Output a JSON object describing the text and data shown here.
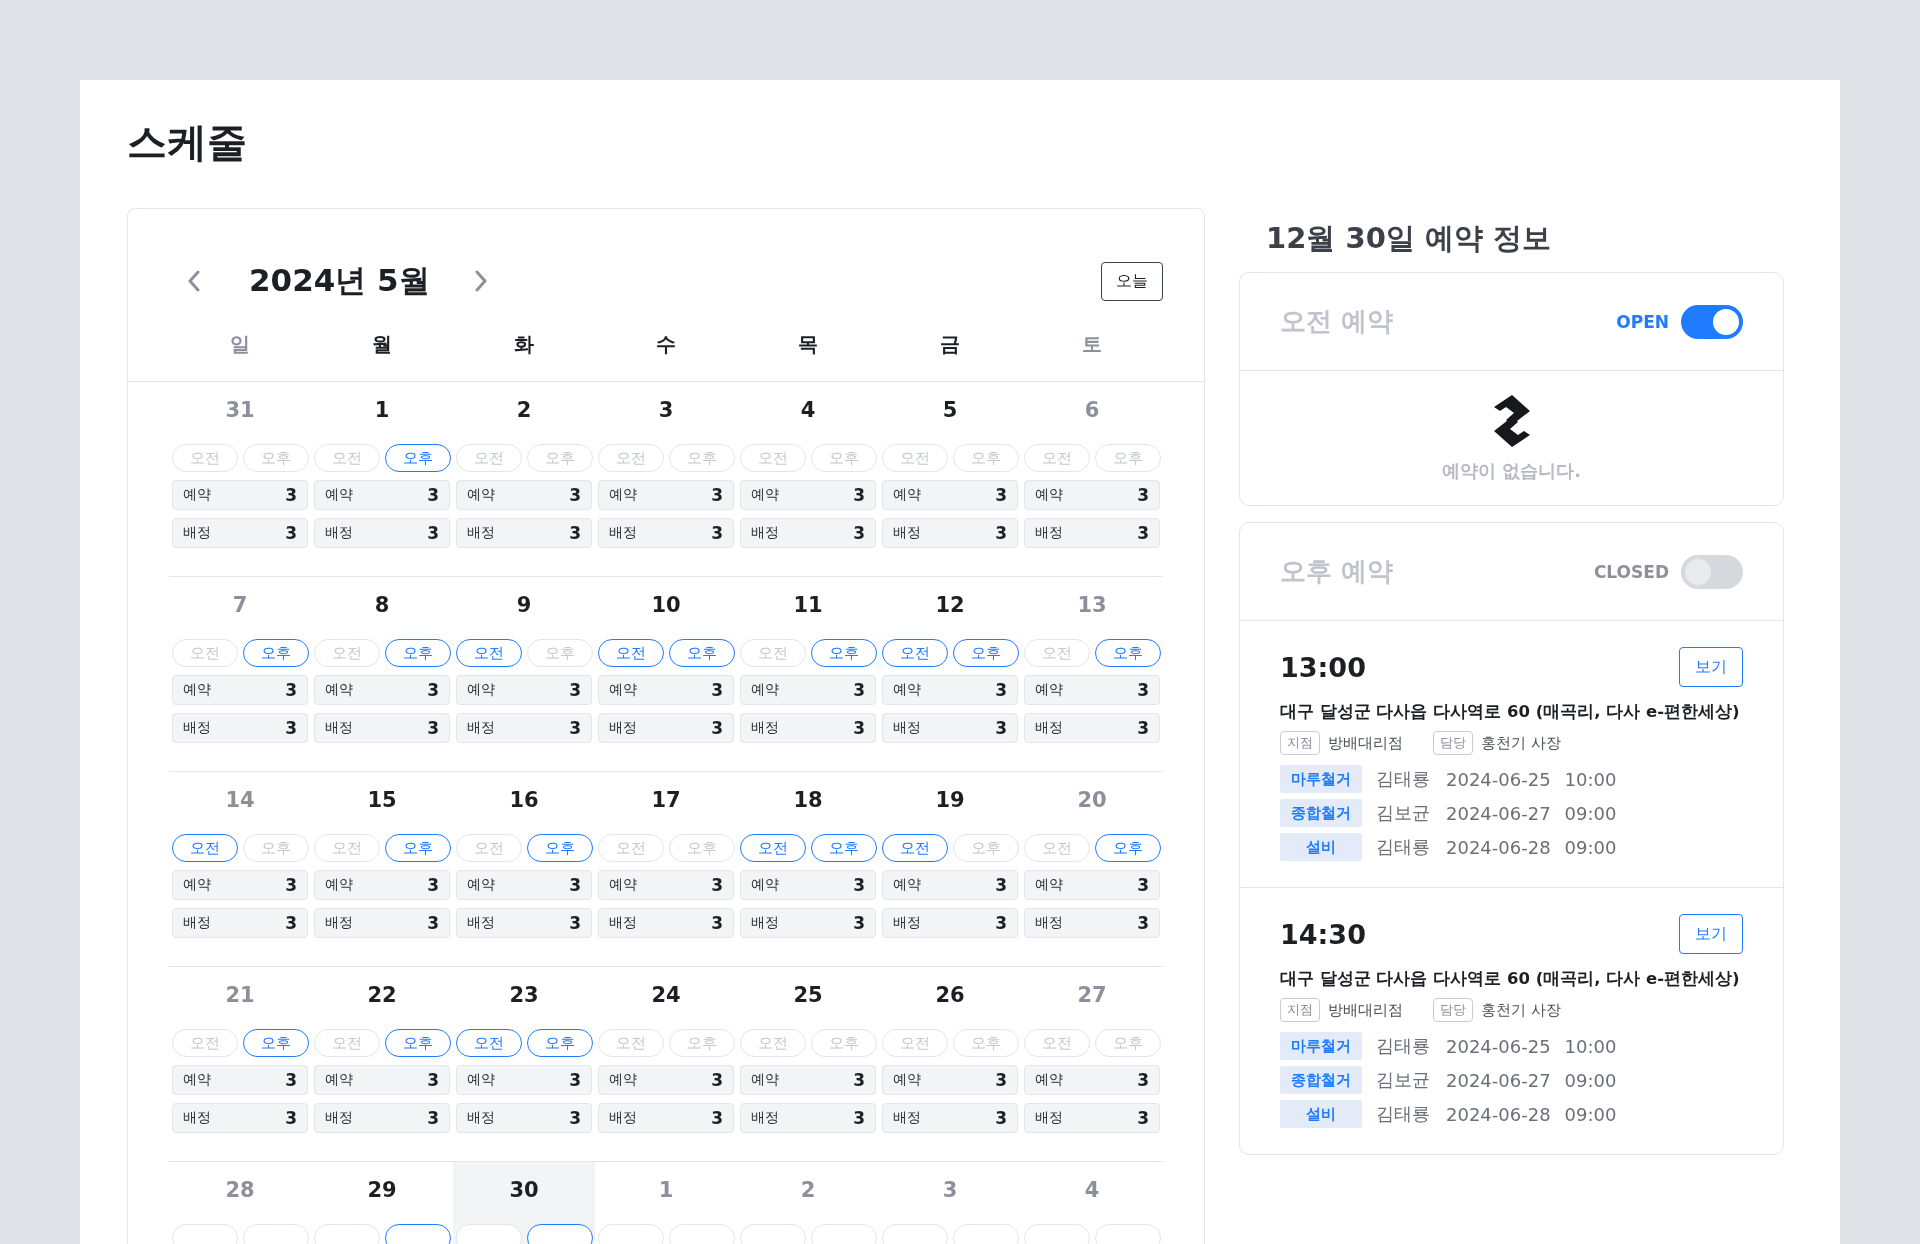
{
  "page": {
    "title": "스케줄"
  },
  "calendar": {
    "month_title": "2024년 5월",
    "today_button": "오늘",
    "weekdays": [
      {
        "label": "일",
        "muted": true
      },
      {
        "label": "월",
        "muted": false
      },
      {
        "label": "화",
        "muted": false
      },
      {
        "label": "수",
        "muted": false
      },
      {
        "label": "목",
        "muted": false
      },
      {
        "label": "금",
        "muted": false
      },
      {
        "label": "토",
        "muted": true
      }
    ],
    "weeks": [
      {
        "days": [
          {
            "date": "31",
            "muted": true,
            "selected": false,
            "slots": [
              {
                "label": "오전",
                "selected": false
              },
              {
                "label": "오후",
                "selected": false
              }
            ],
            "counts": [
              {
                "label": "예약",
                "value": "3"
              },
              {
                "label": "배정",
                "value": "3"
              }
            ]
          },
          {
            "date": "1",
            "muted": false,
            "selected": false,
            "slots": [
              {
                "label": "오전",
                "selected": false
              },
              {
                "label": "오후",
                "selected": true
              }
            ],
            "counts": [
              {
                "label": "예약",
                "value": "3"
              },
              {
                "label": "배정",
                "value": "3"
              }
            ]
          },
          {
            "date": "2",
            "muted": false,
            "selected": false,
            "slots": [
              {
                "label": "오전",
                "selected": false
              },
              {
                "label": "오후",
                "selected": false
              }
            ],
            "counts": [
              {
                "label": "예약",
                "value": "3"
              },
              {
                "label": "배정",
                "value": "3"
              }
            ]
          },
          {
            "date": "3",
            "muted": false,
            "selected": false,
            "slots": [
              {
                "label": "오전",
                "selected": false
              },
              {
                "label": "오후",
                "selected": false
              }
            ],
            "counts": [
              {
                "label": "예약",
                "value": "3"
              },
              {
                "label": "배정",
                "value": "3"
              }
            ]
          },
          {
            "date": "4",
            "muted": false,
            "selected": false,
            "slots": [
              {
                "label": "오전",
                "selected": false
              },
              {
                "label": "오후",
                "selected": false
              }
            ],
            "counts": [
              {
                "label": "예약",
                "value": "3"
              },
              {
                "label": "배정",
                "value": "3"
              }
            ]
          },
          {
            "date": "5",
            "muted": false,
            "selected": false,
            "slots": [
              {
                "label": "오전",
                "selected": false
              },
              {
                "label": "오후",
                "selected": false
              }
            ],
            "counts": [
              {
                "label": "예약",
                "value": "3"
              },
              {
                "label": "배정",
                "value": "3"
              }
            ]
          },
          {
            "date": "6",
            "muted": true,
            "selected": false,
            "slots": [
              {
                "label": "오전",
                "selected": false
              },
              {
                "label": "오후",
                "selected": false
              }
            ],
            "counts": [
              {
                "label": "예약",
                "value": "3"
              },
              {
                "label": "배정",
                "value": "3"
              }
            ]
          }
        ]
      },
      {
        "days": [
          {
            "date": "7",
            "muted": true,
            "selected": false,
            "slots": [
              {
                "label": "오전",
                "selected": false
              },
              {
                "label": "오후",
                "selected": true
              }
            ],
            "counts": [
              {
                "label": "예약",
                "value": "3"
              },
              {
                "label": "배정",
                "value": "3"
              }
            ]
          },
          {
            "date": "8",
            "muted": false,
            "selected": false,
            "slots": [
              {
                "label": "오전",
                "selected": false
              },
              {
                "label": "오후",
                "selected": true
              }
            ],
            "counts": [
              {
                "label": "예약",
                "value": "3"
              },
              {
                "label": "배정",
                "value": "3"
              }
            ]
          },
          {
            "date": "9",
            "muted": false,
            "selected": false,
            "slots": [
              {
                "label": "오전",
                "selected": true
              },
              {
                "label": "오후",
                "selected": false
              }
            ],
            "counts": [
              {
                "label": "예약",
                "value": "3"
              },
              {
                "label": "배정",
                "value": "3"
              }
            ]
          },
          {
            "date": "10",
            "muted": false,
            "selected": false,
            "slots": [
              {
                "label": "오전",
                "selected": true
              },
              {
                "label": "오후",
                "selected": true
              }
            ],
            "counts": [
              {
                "label": "예약",
                "value": "3"
              },
              {
                "label": "배정",
                "value": "3"
              }
            ]
          },
          {
            "date": "11",
            "muted": false,
            "selected": false,
            "slots": [
              {
                "label": "오전",
                "selected": false
              },
              {
                "label": "오후",
                "selected": true
              }
            ],
            "counts": [
              {
                "label": "예약",
                "value": "3"
              },
              {
                "label": "배정",
                "value": "3"
              }
            ]
          },
          {
            "date": "12",
            "muted": false,
            "selected": false,
            "slots": [
              {
                "label": "오전",
                "selected": true
              },
              {
                "label": "오후",
                "selected": true
              }
            ],
            "counts": [
              {
                "label": "예약",
                "value": "3"
              },
              {
                "label": "배정",
                "value": "3"
              }
            ]
          },
          {
            "date": "13",
            "muted": true,
            "selected": false,
            "slots": [
              {
                "label": "오전",
                "selected": false
              },
              {
                "label": "오후",
                "selected": true
              }
            ],
            "counts": [
              {
                "label": "예약",
                "value": "3"
              },
              {
                "label": "배정",
                "value": "3"
              }
            ]
          }
        ]
      },
      {
        "days": [
          {
            "date": "14",
            "muted": true,
            "selected": false,
            "slots": [
              {
                "label": "오전",
                "selected": true
              },
              {
                "label": "오후",
                "selected": false
              }
            ],
            "counts": [
              {
                "label": "예약",
                "value": "3"
              },
              {
                "label": "배정",
                "value": "3"
              }
            ]
          },
          {
            "date": "15",
            "muted": false,
            "selected": false,
            "slots": [
              {
                "label": "오전",
                "selected": false
              },
              {
                "label": "오후",
                "selected": true
              }
            ],
            "counts": [
              {
                "label": "예약",
                "value": "3"
              },
              {
                "label": "배정",
                "value": "3"
              }
            ]
          },
          {
            "date": "16",
            "muted": false,
            "selected": false,
            "slots": [
              {
                "label": "오전",
                "selected": false
              },
              {
                "label": "오후",
                "selected": true
              }
            ],
            "counts": [
              {
                "label": "예약",
                "value": "3"
              },
              {
                "label": "배정",
                "value": "3"
              }
            ]
          },
          {
            "date": "17",
            "muted": false,
            "selected": false,
            "slots": [
              {
                "label": "오전",
                "selected": false
              },
              {
                "label": "오후",
                "selected": false
              }
            ],
            "counts": [
              {
                "label": "예약",
                "value": "3"
              },
              {
                "label": "배정",
                "value": "3"
              }
            ]
          },
          {
            "date": "18",
            "muted": false,
            "selected": false,
            "slots": [
              {
                "label": "오전",
                "selected": true
              },
              {
                "label": "오후",
                "selected": true
              }
            ],
            "counts": [
              {
                "label": "예약",
                "value": "3"
              },
              {
                "label": "배정",
                "value": "3"
              }
            ]
          },
          {
            "date": "19",
            "muted": false,
            "selected": false,
            "slots": [
              {
                "label": "오전",
                "selected": true
              },
              {
                "label": "오후",
                "selected": false
              }
            ],
            "counts": [
              {
                "label": "예약",
                "value": "3"
              },
              {
                "label": "배정",
                "value": "3"
              }
            ]
          },
          {
            "date": "20",
            "muted": true,
            "selected": false,
            "slots": [
              {
                "label": "오전",
                "selected": false
              },
              {
                "label": "오후",
                "selected": true
              }
            ],
            "counts": [
              {
                "label": "예약",
                "value": "3"
              },
              {
                "label": "배정",
                "value": "3"
              }
            ]
          }
        ]
      },
      {
        "days": [
          {
            "date": "21",
            "muted": true,
            "selected": false,
            "slots": [
              {
                "label": "오전",
                "selected": false
              },
              {
                "label": "오후",
                "selected": true
              }
            ],
            "counts": [
              {
                "label": "예약",
                "value": "3"
              },
              {
                "label": "배정",
                "value": "3"
              }
            ]
          },
          {
            "date": "22",
            "muted": false,
            "selected": false,
            "slots": [
              {
                "label": "오전",
                "selected": false
              },
              {
                "label": "오후",
                "selected": true
              }
            ],
            "counts": [
              {
                "label": "예약",
                "value": "3"
              },
              {
                "label": "배정",
                "value": "3"
              }
            ]
          },
          {
            "date": "23",
            "muted": false,
            "selected": false,
            "slots": [
              {
                "label": "오전",
                "selected": true
              },
              {
                "label": "오후",
                "selected": true
              }
            ],
            "counts": [
              {
                "label": "예약",
                "value": "3"
              },
              {
                "label": "배정",
                "value": "3"
              }
            ]
          },
          {
            "date": "24",
            "muted": false,
            "selected": false,
            "slots": [
              {
                "label": "오전",
                "selected": false
              },
              {
                "label": "오후",
                "selected": false
              }
            ],
            "counts": [
              {
                "label": "예약",
                "value": "3"
              },
              {
                "label": "배정",
                "value": "3"
              }
            ]
          },
          {
            "date": "25",
            "muted": false,
            "selected": false,
            "slots": [
              {
                "label": "오전",
                "selected": false
              },
              {
                "label": "오후",
                "selected": false
              }
            ],
            "counts": [
              {
                "label": "예약",
                "value": "3"
              },
              {
                "label": "배정",
                "value": "3"
              }
            ]
          },
          {
            "date": "26",
            "muted": false,
            "selected": false,
            "slots": [
              {
                "label": "오전",
                "selected": false
              },
              {
                "label": "오후",
                "selected": false
              }
            ],
            "counts": [
              {
                "label": "예약",
                "value": "3"
              },
              {
                "label": "배정",
                "value": "3"
              }
            ]
          },
          {
            "date": "27",
            "muted": true,
            "selected": false,
            "slots": [
              {
                "label": "오전",
                "selected": false
              },
              {
                "label": "오후",
                "selected": false
              }
            ],
            "counts": [
              {
                "label": "예약",
                "value": "3"
              },
              {
                "label": "배정",
                "value": "3"
              }
            ]
          }
        ]
      },
      {
        "days": [
          {
            "date": "28",
            "muted": true,
            "selected": false,
            "slots": [
              {
                "selected": false
              },
              {
                "selected": false
              }
            ]
          },
          {
            "date": "29",
            "muted": false,
            "selected": false,
            "slots": [
              {
                "selected": false
              },
              {
                "selected": true
              }
            ]
          },
          {
            "date": "30",
            "muted": false,
            "selected": true,
            "slots": [
              {
                "selected": false
              },
              {
                "selected": true
              }
            ]
          },
          {
            "date": "1",
            "muted": true,
            "selected": false,
            "slots": [
              {
                "selected": false
              },
              {
                "selected": false
              }
            ]
          },
          {
            "date": "2",
            "muted": true,
            "selected": false,
            "slots": [
              {
                "selected": false
              },
              {
                "selected": false
              }
            ]
          },
          {
            "date": "3",
            "muted": true,
            "selected": false,
            "slots": [
              {
                "selected": false
              },
              {
                "selected": false
              }
            ]
          },
          {
            "date": "4",
            "muted": true,
            "selected": false,
            "slots": [
              {
                "selected": false
              },
              {
                "selected": false
              }
            ]
          }
        ]
      }
    ]
  },
  "detail": {
    "heading": "12월 30일 예약 정보",
    "sections": [
      {
        "title": "오전 예약",
        "status": "OPEN",
        "on": true,
        "empty_text": "예약이 없습니다."
      },
      {
        "title": "오후 예약",
        "status": "CLOSED",
        "on": false,
        "bookings": [
          {
            "time": "13:00",
            "view_button": "보기",
            "address": "대구 달성군 다사읍 다사역로 60 (매곡리, 다사 e-편한세상)",
            "branch_tag": "지점",
            "branch": "방배대리점",
            "manager_tag": "담당",
            "manager": "홍천기 사장",
            "jobs": [
              {
                "type": "마루철거",
                "worker": "김태룡",
                "date": "2024-06-25",
                "time": "10:00"
              },
              {
                "type": "종합철거",
                "worker": "김보균",
                "date": "2024-06-27",
                "time": "09:00"
              },
              {
                "type": "설비",
                "worker": "김태룡",
                "date": "2024-06-28",
                "time": "09:00"
              }
            ]
          },
          {
            "time": "14:30",
            "view_button": "보기",
            "address": "대구 달성군 다사읍 다사역로 60 (매곡리, 다사 e-편한세상)",
            "branch_tag": "지점",
            "branch": "방배대리점",
            "manager_tag": "담당",
            "manager": "홍천기 사장",
            "jobs": [
              {
                "type": "마루철거",
                "worker": "김태룡",
                "date": "2024-06-25",
                "time": "10:00"
              },
              {
                "type": "종합철거",
                "worker": "김보균",
                "date": "2024-06-27",
                "time": "09:00"
              },
              {
                "type": "설비",
                "worker": "김태룡",
                "date": "2024-06-28",
                "time": "09:00"
              }
            ]
          }
        ]
      }
    ]
  }
}
